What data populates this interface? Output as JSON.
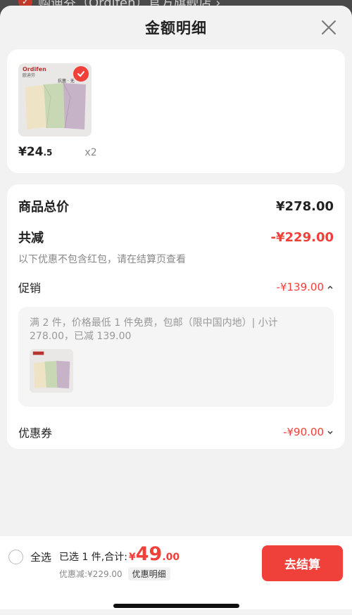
{
  "background": {
    "store_text": "购迪芬（Ordifen）官方旗舰店 ›"
  },
  "sheet": {
    "title": "金额明细"
  },
  "product": {
    "brand_en": "Ordifen",
    "brand_cn": "欧迪芬",
    "tag": "抗菌 · 无",
    "price_int": "¥24",
    "price_dec": ".5",
    "qty": "x2"
  },
  "detail": {
    "total_label": "商品总价",
    "total_value": "¥278.00",
    "reduce_label": "共减",
    "reduce_value": "-¥229.00",
    "note": "以下优惠不包含红包，请在结算页查看",
    "promo_label": "促销",
    "promo_value": "-¥139.00",
    "promo_desc": "满 2 件，价格最低 1 件免费，包邮（限中国内地）| 小计 278.00，已减 139.00",
    "coupon_label": "优惠券",
    "coupon_value": "-¥90.00"
  },
  "bottom": {
    "select_all": "全选",
    "selected_prefix": "已选 1 件,合计:",
    "currency": "¥",
    "total_int": "49",
    "total_dec": ".00",
    "reduced_text": "优惠减:¥229.00",
    "detail_chip": "优惠明细",
    "checkout": "去结算"
  },
  "colors": {
    "accent": "#f0403a",
    "text": "#222222",
    "muted": "#888888"
  }
}
